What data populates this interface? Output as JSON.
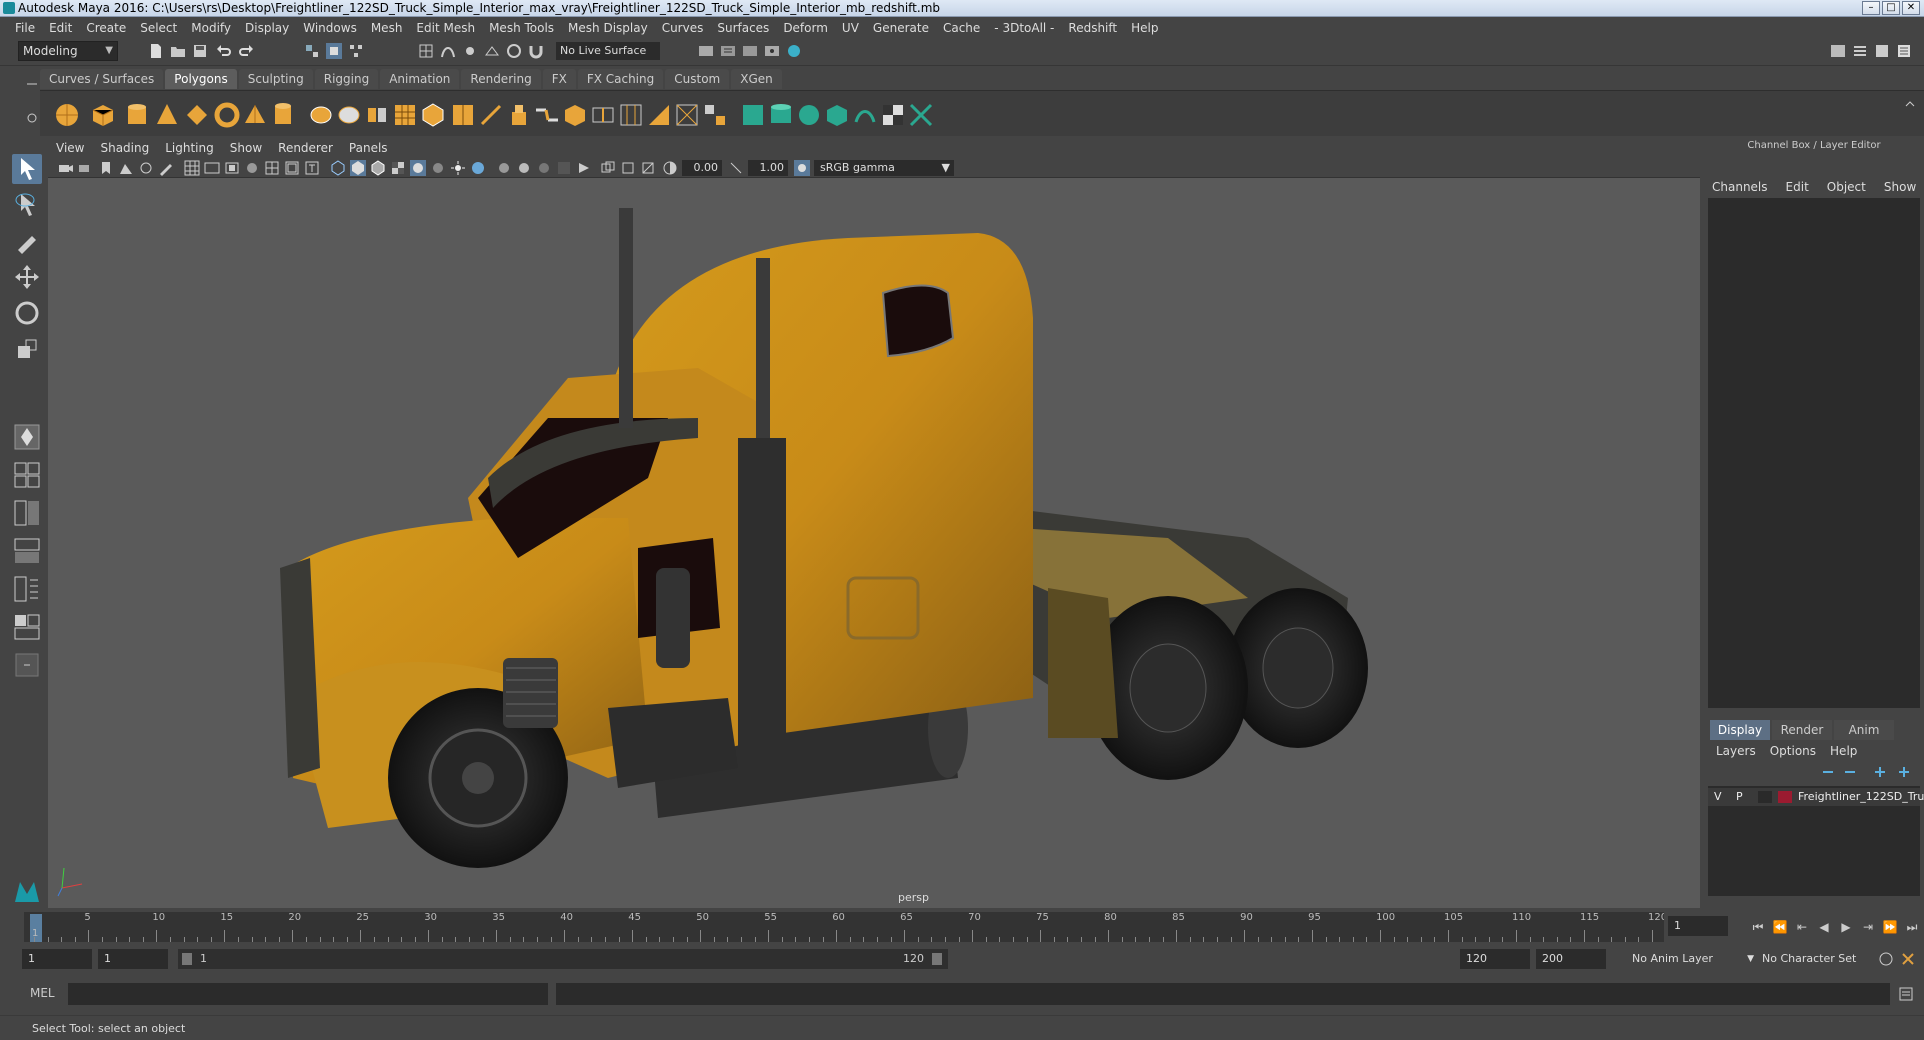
{
  "window": {
    "title": "Autodesk Maya 2016: C:\\Users\\rs\\Desktop\\Freightliner_122SD_Truck_Simple_Interior_max_vray\\Freightliner_122SD_Truck_Simple_Interior_mb_redshift.mb",
    "min": "–",
    "max": "□",
    "close": "✕"
  },
  "menu": [
    "File",
    "Edit",
    "Create",
    "Select",
    "Modify",
    "Display",
    "Windows",
    "Mesh",
    "Edit Mesh",
    "Mesh Tools",
    "Mesh Display",
    "Curves",
    "Surfaces",
    "Deform",
    "UV",
    "Generate",
    "Cache",
    "- 3DtoAll -",
    "Redshift",
    "Help"
  ],
  "status": {
    "mode": "Modeling",
    "live_surface": "No Live Surface"
  },
  "shelf_tabs": [
    {
      "label": "Curves / Surfaces",
      "active": false
    },
    {
      "label": "Polygons",
      "active": true
    },
    {
      "label": "Sculpting",
      "active": false
    },
    {
      "label": "Rigging",
      "active": false
    },
    {
      "label": "Animation",
      "active": false
    },
    {
      "label": "Rendering",
      "active": false
    },
    {
      "label": "FX",
      "active": false
    },
    {
      "label": "FX Caching",
      "active": false
    },
    {
      "label": "Custom",
      "active": false
    },
    {
      "label": "XGen",
      "active": false
    }
  ],
  "panel_menu": [
    "View",
    "Shading",
    "Lighting",
    "Show",
    "Renderer",
    "Panels"
  ],
  "view_toolbar": {
    "exposure": "0.00",
    "gamma": "1.00",
    "color_space": "sRGB gamma"
  },
  "viewport": {
    "camera": "persp"
  },
  "channel_box": {
    "title": "Channel Box / Layer Editor",
    "menu": [
      "Channels",
      "Edit",
      "Object",
      "Show"
    ]
  },
  "layer_editor": {
    "tabs": [
      {
        "label": "Display",
        "active": true
      },
      {
        "label": "Render",
        "active": false
      },
      {
        "label": "Anim",
        "active": false
      }
    ],
    "menu": [
      "Layers",
      "Options",
      "Help"
    ],
    "layers": [
      {
        "v": "V",
        "p": "P",
        "name": "Freightliner_122SD_Tru",
        "color": "#9b1b30"
      }
    ]
  },
  "timeline": {
    "ticks": [
      "5",
      "10",
      "15",
      "20",
      "25",
      "30",
      "35",
      "40",
      "45",
      "50",
      "55",
      "60",
      "65",
      "70",
      "75",
      "80",
      "85",
      "90",
      "95",
      "100",
      "105",
      "110",
      "115",
      "120"
    ],
    "start_label": "1",
    "current_frame": "1"
  },
  "range": {
    "start": "1",
    "playback_start": "1",
    "slider_start": "1",
    "slider_end": "120",
    "playback_end": "120",
    "end": "200",
    "anim_layer": "No Anim Layer",
    "character_set": "No Character Set"
  },
  "command_line": {
    "language": "MEL"
  },
  "help_line": "Select Tool: select an object"
}
